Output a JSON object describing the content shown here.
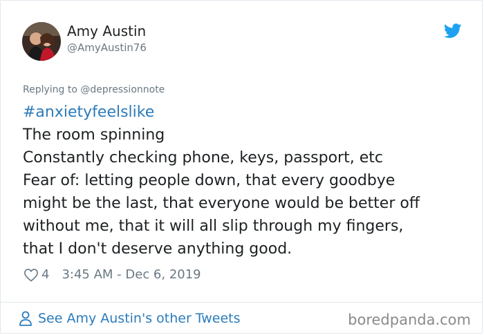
{
  "author": {
    "name": "Amy Austin",
    "handle": "@AmyAustin76"
  },
  "reply": {
    "prefix": "Replying to",
    "handle": "@depressionnote"
  },
  "tweet": {
    "hashtag": "#anxietyfeelslike",
    "lines": [
      "The room spinning",
      "Constantly checking phone, keys, passport, etc",
      "Fear of: letting people down, that every goodbye",
      "might be the last, that everyone would be better off",
      "without me, that it will all slip through my fingers,",
      "that I don't deserve anything good."
    ]
  },
  "meta": {
    "likes": "4",
    "timestamp": "3:45 AM - Dec 6, 2019"
  },
  "footer": {
    "link_label": "See Amy Austin's other Tweets",
    "watermark": "boredpanda.com"
  },
  "icons": {
    "brand": "twitter-bird-icon",
    "like": "heart-icon",
    "profile": "person-icon"
  },
  "colors": {
    "link": "#2b7bb9",
    "muted": "#697882",
    "twitter_blue": "#1da1f2"
  }
}
